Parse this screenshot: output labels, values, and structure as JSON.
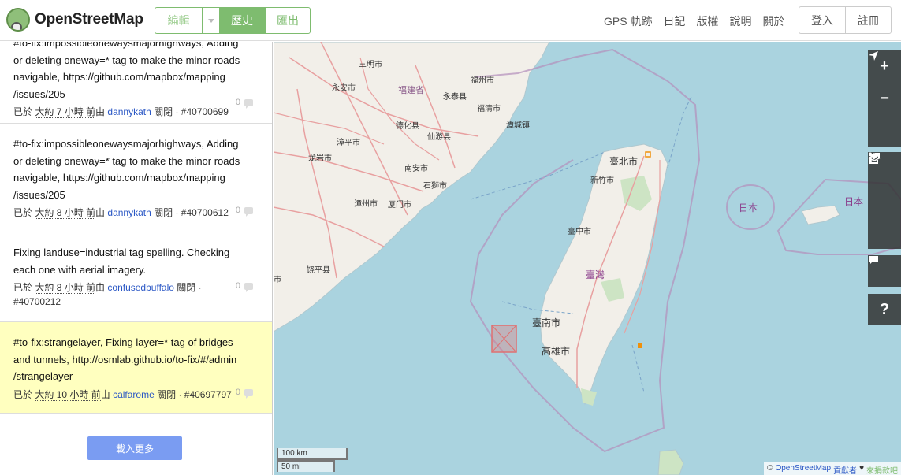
{
  "header": {
    "logo_text": "OpenStreetMap",
    "edit_label": "編輯",
    "history_label": "歷史",
    "export_label": "匯出",
    "nav": [
      "GPS 軌跡",
      "日記",
      "版權",
      "說明",
      "關於"
    ],
    "login_label": "登入",
    "signup_label": "註冊"
  },
  "changesets": [
    {
      "comment": "#to-fix:impossibleonewaysmajorhighways, Adding or deleting oneway=* tag to make the minor roads navigable, https://github.com/mapbox/mapping/issues/205",
      "lines": [
        "#to-fix:impossibleonewaysmajorhighways, Adding",
        "or deleting oneway=* tag to make the minor roads",
        "navigable, https://github.com/mapbox/mapping",
        "/issues/205"
      ],
      "prefix": "已於",
      "time": "大約 7 小時 前",
      "by": "由",
      "user": "dannykath",
      "status": "關閉 · #40700699",
      "count": "0"
    },
    {
      "comment": "#to-fix:impossibleonewaysmajorhighways, Adding or deleting oneway=* tag to make the minor roads navigable, https://github.com/mapbox/mapping/issues/205",
      "lines": [
        "#to-fix:impossibleonewaysmajorhighways, Adding",
        "or deleting oneway=* tag to make the minor roads",
        "navigable, https://github.com/mapbox/mapping",
        "/issues/205"
      ],
      "prefix": "已於",
      "time": "大約 8 小時 前",
      "by": "由",
      "user": "dannykath",
      "status": "關閉 · #40700612",
      "count": "0"
    },
    {
      "comment": "Fixing landuse=industrial tag spelling. Checking each one with aerial imagery.",
      "lines": [
        "Fixing landuse=industrial tag spelling. Checking",
        "each one with aerial imagery."
      ],
      "prefix": "已於",
      "time": "大約 8 小時 前",
      "by": "由",
      "user": "confusedbuffalo",
      "status": "關閉 ·",
      "status2": "#40700212",
      "count": "0"
    },
    {
      "comment": "#to-fix:strangelayer, Fixing layer=* tag of bridges and tunnels, http://osmlab.github.io/to-fix/#/admin/strangelayer",
      "lines": [
        "#to-fix:strangelayer, Fixing layer=* tag of bridges",
        "and tunnels, http://osmlab.github.io/to-fix/#/admin",
        "/strangelayer"
      ],
      "prefix": "已於",
      "time": "大約 10 小時 前",
      "by": "由",
      "user": "calfarome",
      "status": "關閉 · #40697797",
      "count": "0"
    }
  ],
  "load_more_label": "載入更多",
  "map": {
    "labels": {
      "sanming": "三明市",
      "yongan": "永安市",
      "fujian": "福建省",
      "fuzhou": "福州市",
      "yongtai": "永泰县",
      "fuqing": "福清市",
      "tantou": "潭城镇",
      "dehua": "德化县",
      "xianyou": "仙游县",
      "zhangping": "漳平市",
      "longyan": "龙岩市",
      "nanan": "南安市",
      "shishi": "石獅市",
      "zhangzhou": "漳州市",
      "xiamen": "厦门市",
      "raoping": "饶平县",
      "taipei": "臺北市",
      "hsinchu": "新竹市",
      "taichung": "臺中市",
      "taiwan": "臺灣",
      "tainan": "臺南市",
      "kaohsiung": "高雄市",
      "japan1": "日本",
      "japan2": "日本",
      "partial": "市"
    },
    "scale_km": "100 km",
    "scale_mi": "50 mi",
    "attribution_prefix": "©",
    "attribution_link": "OpenStreetMap",
    "attribution_contrib": "貢獻者",
    "attribution_heart": "♥",
    "attribution_donate": "來捐款吧"
  }
}
